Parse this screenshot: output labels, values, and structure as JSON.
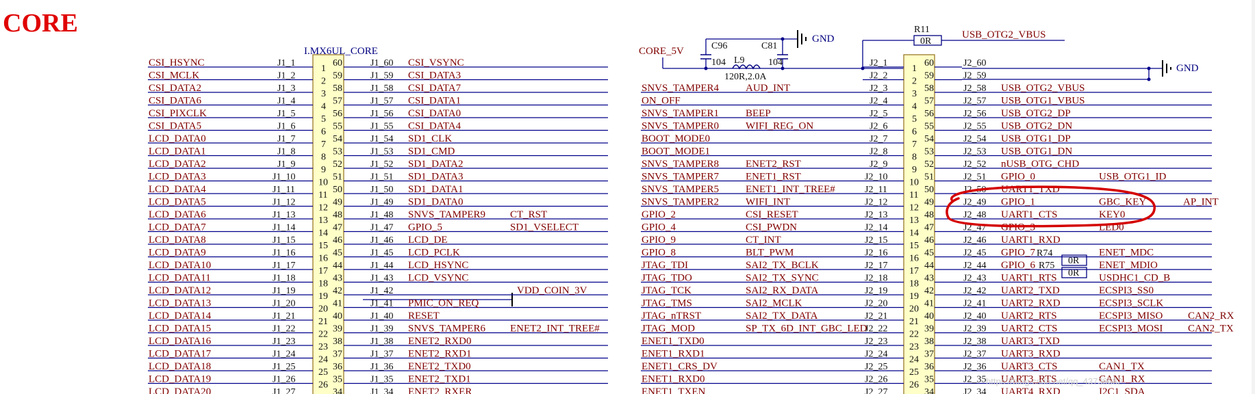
{
  "page": {
    "title": "CORE"
  },
  "j1": {
    "label": "I.MX6UL_CORE",
    "rows": [
      {
        "left": "CSI_HSYNC",
        "ref": "J1_1",
        "a": "1",
        "b": "60",
        "rref": "J1_60",
        "right": "CSI_VSYNC",
        "ext": ""
      },
      {
        "left": "CSI_MCLK",
        "ref": "J1_2",
        "a": "2",
        "b": "59",
        "rref": "J1_59",
        "right": "CSI_DATA3",
        "ext": ""
      },
      {
        "left": "CSI_DATA2",
        "ref": "J1_3",
        "a": "3",
        "b": "58",
        "rref": "J1_58",
        "right": "CSI_DATA7",
        "ext": ""
      },
      {
        "left": "CSI_DATA6",
        "ref": "J1_4",
        "a": "4",
        "b": "57",
        "rref": "J1_57",
        "right": "CSI_DATA1",
        "ext": ""
      },
      {
        "left": "CSI_PIXCLK",
        "ref": "J1_5",
        "a": "5",
        "b": "56",
        "rref": "J1_56",
        "right": "CSI_DATA0",
        "ext": ""
      },
      {
        "left": "CSI_DATA5",
        "ref": "J1_6",
        "a": "6",
        "b": "55",
        "rref": "J1_55",
        "right": "CSI_DATA4",
        "ext": ""
      },
      {
        "left": "LCD_DATA0",
        "ref": "J1_7",
        "a": "7",
        "b": "54",
        "rref": "J1_54",
        "right": "SD1_CLK",
        "ext": ""
      },
      {
        "left": "LCD_DATA1",
        "ref": "J1_8",
        "a": "8",
        "b": "53",
        "rref": "J1_53",
        "right": "SD1_CMD",
        "ext": ""
      },
      {
        "left": "LCD_DATA2",
        "ref": "J1_9",
        "a": "9",
        "b": "52",
        "rref": "J1_52",
        "right": "SD1_DATA2",
        "ext": ""
      },
      {
        "left": "LCD_DATA3",
        "ref": "J1_10",
        "a": "10",
        "b": "51",
        "rref": "J1_51",
        "right": "SD1_DATA3",
        "ext": ""
      },
      {
        "left": "LCD_DATA4",
        "ref": "J1_11",
        "a": "11",
        "b": "50",
        "rref": "J1_50",
        "right": "SD1_DATA1",
        "ext": ""
      },
      {
        "left": "LCD_DATA5",
        "ref": "J1_12",
        "a": "12",
        "b": "49",
        "rref": "J1_49",
        "right": "SD1_DATA0",
        "ext": ""
      },
      {
        "left": "LCD_DATA6",
        "ref": "J1_13",
        "a": "13",
        "b": "48",
        "rref": "J1_48",
        "right": "SNVS_TAMPER9",
        "ext": "CT_RST"
      },
      {
        "left": "LCD_DATA7",
        "ref": "J1_14",
        "a": "14",
        "b": "47",
        "rref": "J1_47",
        "right": "GPIO_5",
        "ext": "SD1_VSELECT"
      },
      {
        "left": "LCD_DATA8",
        "ref": "J1_15",
        "a": "15",
        "b": "46",
        "rref": "J1_46",
        "right": "LCD_DE",
        "ext": ""
      },
      {
        "left": "LCD_DATA9",
        "ref": "J1_16",
        "a": "16",
        "b": "45",
        "rref": "J1_45",
        "right": "LCD_PCLK",
        "ext": ""
      },
      {
        "left": "LCD_DATA10",
        "ref": "J1_17",
        "a": "17",
        "b": "44",
        "rref": "J1_44",
        "right": "LCD_HSYNC",
        "ext": ""
      },
      {
        "left": "LCD_DATA11",
        "ref": "J1_18",
        "a": "18",
        "b": "43",
        "rref": "J1_43",
        "right": "LCD_VSYNC",
        "ext": ""
      },
      {
        "left": "LCD_DATA12",
        "ref": "J1_19",
        "a": "19",
        "b": "42",
        "rref": "J1_42",
        "right": "",
        "ext": "VDD_COIN_3V"
      },
      {
        "left": "LCD_DATA13",
        "ref": "J1_20",
        "a": "20",
        "b": "41",
        "rref": "J1_41",
        "right": "PMIC_ON_REQ",
        "ext": ""
      },
      {
        "left": "LCD_DATA14",
        "ref": "J1_21",
        "a": "21",
        "b": "40",
        "rref": "J1_40",
        "right": "RESET",
        "ext": ""
      },
      {
        "left": "LCD_DATA15",
        "ref": "J1_22",
        "a": "22",
        "b": "39",
        "rref": "J1_39",
        "right": "SNVS_TAMPER6",
        "ext": "ENET2_INT_TREE#"
      },
      {
        "left": "LCD_DATA16",
        "ref": "J1_23",
        "a": "23",
        "b": "38",
        "rref": "J1_38",
        "right": "ENET2_RXD0",
        "ext": ""
      },
      {
        "left": "LCD_DATA17",
        "ref": "J1_24",
        "a": "24",
        "b": "37",
        "rref": "J1_37",
        "right": "ENET2_RXD1",
        "ext": ""
      },
      {
        "left": "LCD_DATA18",
        "ref": "J1_25",
        "a": "25",
        "b": "36",
        "rref": "J1_36",
        "right": "ENET2_TXD0",
        "ext": ""
      },
      {
        "left": "LCD_DATA19",
        "ref": "J1_26",
        "a": "26",
        "b": "35",
        "rref": "J1_35",
        "right": "ENET2_TXD1",
        "ext": ""
      },
      {
        "left": "LCD_DATA20",
        "ref": "J1_27",
        "a": "27",
        "b": "34",
        "rref": "J1_34",
        "right": "ENET2_RXER",
        "ext": ""
      }
    ]
  },
  "j2": {
    "rows": [
      {
        "net": "",
        "func": "",
        "ref": "J2_1",
        "a": "1",
        "b": "60",
        "rref": "J2_60",
        "right": "",
        "ext": "",
        "ext2": ""
      },
      {
        "net": "",
        "func": "",
        "ref": "J2_2",
        "a": "2",
        "b": "59",
        "rref": "J2_59",
        "right": "",
        "ext": "",
        "ext2": ""
      },
      {
        "net": "SNVS_TAMPER4",
        "func": "AUD_INT",
        "ref": "J2_3",
        "a": "3",
        "b": "58",
        "rref": "J2_58",
        "right": "USB_OTG2_VBUS",
        "ext": "",
        "ext2": ""
      },
      {
        "net": "ON_OFF",
        "func": "",
        "ref": "J2_4",
        "a": "4",
        "b": "57",
        "rref": "J2_57",
        "right": "USB_OTG1_VBUS",
        "ext": "",
        "ext2": ""
      },
      {
        "net": "SNVS_TAMPER1",
        "func": "BEEP",
        "ref": "J2_5",
        "a": "5",
        "b": "56",
        "rref": "J2_56",
        "right": "USB_OTG2_DP",
        "ext": "",
        "ext2": ""
      },
      {
        "net": "SNVS_TAMPER0",
        "func": "WIFI_REG_ON",
        "ref": "J2_6",
        "a": "6",
        "b": "55",
        "rref": "J2_55",
        "right": "USB_OTG2_DN",
        "ext": "",
        "ext2": ""
      },
      {
        "net": "BOOT_MODE0",
        "func": "",
        "ref": "J2_7",
        "a": "7",
        "b": "54",
        "rref": "J2_54",
        "right": "USB_OTG1_DP",
        "ext": "",
        "ext2": ""
      },
      {
        "net": "BOOT_MODE1",
        "func": "",
        "ref": "J2_8",
        "a": "8",
        "b": "53",
        "rref": "J2_53",
        "right": "USB_OTG1_DN",
        "ext": "",
        "ext2": ""
      },
      {
        "net": "SNVS_TAMPER8",
        "func": "ENET2_RST",
        "ref": "J2_9",
        "a": "9",
        "b": "52",
        "rref": "J2_52",
        "right": "nUSB_OTG_CHD",
        "ext": "",
        "ext2": ""
      },
      {
        "net": "SNVS_TAMPER7",
        "func": "ENET1_RST",
        "ref": "J2_10",
        "a": "10",
        "b": "51",
        "rref": "J2_51",
        "right": "GPIO_0",
        "ext": "USB_OTG1_ID",
        "ext2": ""
      },
      {
        "net": "SNVS_TAMPER5",
        "func": "ENET1_INT_TREE#",
        "ref": "J2_11",
        "a": "11",
        "b": "50",
        "rref": "J2_50",
        "right": "UART1_TXD",
        "ext": "",
        "ext2": ""
      },
      {
        "net": "SNVS_TAMPER2",
        "func": "WIFI_INT",
        "ref": "J2_12",
        "a": "12",
        "b": "49",
        "rref": "J2_49",
        "right": "GPIO_1",
        "ext": "GBC_KEY",
        "ext2": "AP_INT"
      },
      {
        "net": "GPIO_2",
        "func": "CSI_RESET",
        "ref": "J2_13",
        "a": "13",
        "b": "48",
        "rref": "J2_48",
        "right": "UART1_CTS",
        "ext": "KEY0",
        "ext2": ""
      },
      {
        "net": "GPIO_4",
        "func": "CSI_PWDN",
        "ref": "J2_14",
        "a": "14",
        "b": "47",
        "rref": "J2_47",
        "right": "GPIO_3",
        "ext": "LED0",
        "ext2": ""
      },
      {
        "net": "GPIO_9",
        "func": "CT_INT",
        "ref": "J2_15",
        "a": "15",
        "b": "46",
        "rref": "J2_46",
        "right": "UART1_RXD",
        "ext": "",
        "ext2": ""
      },
      {
        "net": "GPIO_8",
        "func": "BLT_PWM",
        "ref": "J2_16",
        "a": "16",
        "b": "45",
        "rref": "J2_45",
        "right": "GPIO_7",
        "ext": "ENET_MDC",
        "ext2": ""
      },
      {
        "net": "JTAG_TDI",
        "func": "SAI2_TX_BCLK",
        "ref": "J2_17",
        "a": "17",
        "b": "44",
        "rref": "J2_44",
        "right": "GPIO_6",
        "ext": "ENET_MDIO",
        "ext2": ""
      },
      {
        "net": "JTAG_TDO",
        "func": "SAI2_TX_SYNC",
        "ref": "J2_18",
        "a": "18",
        "b": "43",
        "rref": "J2_43",
        "right": "UART1_RTS",
        "ext": "USDHC1_CD_B",
        "ext2": ""
      },
      {
        "net": "JTAG_TCK",
        "func": "SAI2_RX_DATA",
        "ref": "J2_19",
        "a": "19",
        "b": "42",
        "rref": "J2_42",
        "right": "UART2_TXD",
        "ext": "ECSPI3_SS0",
        "ext2": ""
      },
      {
        "net": "JTAG_TMS",
        "func": "SAI2_MCLK",
        "ref": "J2_20",
        "a": "20",
        "b": "41",
        "rref": "J2_41",
        "right": "UART2_RXD",
        "ext": "ECSPI3_SCLK",
        "ext2": ""
      },
      {
        "net": "JTAG_nTRST",
        "func": "SAI2_TX_DATA",
        "ref": "J2_21",
        "a": "21",
        "b": "40",
        "rref": "J2_40",
        "right": "UART2_RTS",
        "ext": "ECSPI3_MISO",
        "ext2": "CAN2_RX"
      },
      {
        "net": "JTAG_MOD",
        "func": "SP_TX_6D_INT_GBC_LED",
        "ref": "J2_22",
        "a": "22",
        "b": "39",
        "rref": "J2_39",
        "right": "UART2_CTS",
        "ext": "ECSPI3_MOSI",
        "ext2": "CAN2_TX"
      },
      {
        "net": "ENET1_TXD0",
        "func": "",
        "ref": "J2_23",
        "a": "23",
        "b": "38",
        "rref": "J2_38",
        "right": "UART3_TXD",
        "ext": "",
        "ext2": ""
      },
      {
        "net": "ENET1_RXD1",
        "func": "",
        "ref": "J2_24",
        "a": "24",
        "b": "37",
        "rref": "J2_37",
        "right": "UART3_RXD",
        "ext": "",
        "ext2": ""
      },
      {
        "net": "ENET1_CRS_DV",
        "func": "",
        "ref": "J2_25",
        "a": "25",
        "b": "36",
        "rref": "J2_36",
        "right": "UART3_CTS",
        "ext": "CAN1_TX",
        "ext2": ""
      },
      {
        "net": "ENET1_RXD0",
        "func": "",
        "ref": "J2_26",
        "a": "26",
        "b": "35",
        "rref": "J2_35",
        "right": "UART3_RTS",
        "ext": "CAN1_RX",
        "ext2": ""
      },
      {
        "net": "ENET1_TXEN",
        "func": "",
        "ref": "J2_27",
        "a": "27",
        "b": "34",
        "rref": "J2_34",
        "right": "UART4_RXD",
        "ext": "I2C1_SDA",
        "ext2": ""
      }
    ]
  },
  "power": {
    "core": "CORE_5V",
    "c96": "C96",
    "c81": "C81",
    "c96_val": "104",
    "c81_val": "104",
    "l9": "L9",
    "l9_val": "120R,2.0A",
    "gnd1": "GND",
    "gnd2": "GND",
    "r11": "R11",
    "r11_val": "0R",
    "usb_vbus": "USB_OTG2_VBUS",
    "r74": "R74",
    "r75": "R75",
    "r74_val": "0R",
    "r75_val": "0R"
  },
  "watermark": "https://blog.csdn.net/qq_43739682",
  "colors": {
    "title": "#e00000",
    "net": "#800000",
    "wire": "#00008b",
    "connector": "#ffffc8",
    "highlight": "#d40000"
  }
}
